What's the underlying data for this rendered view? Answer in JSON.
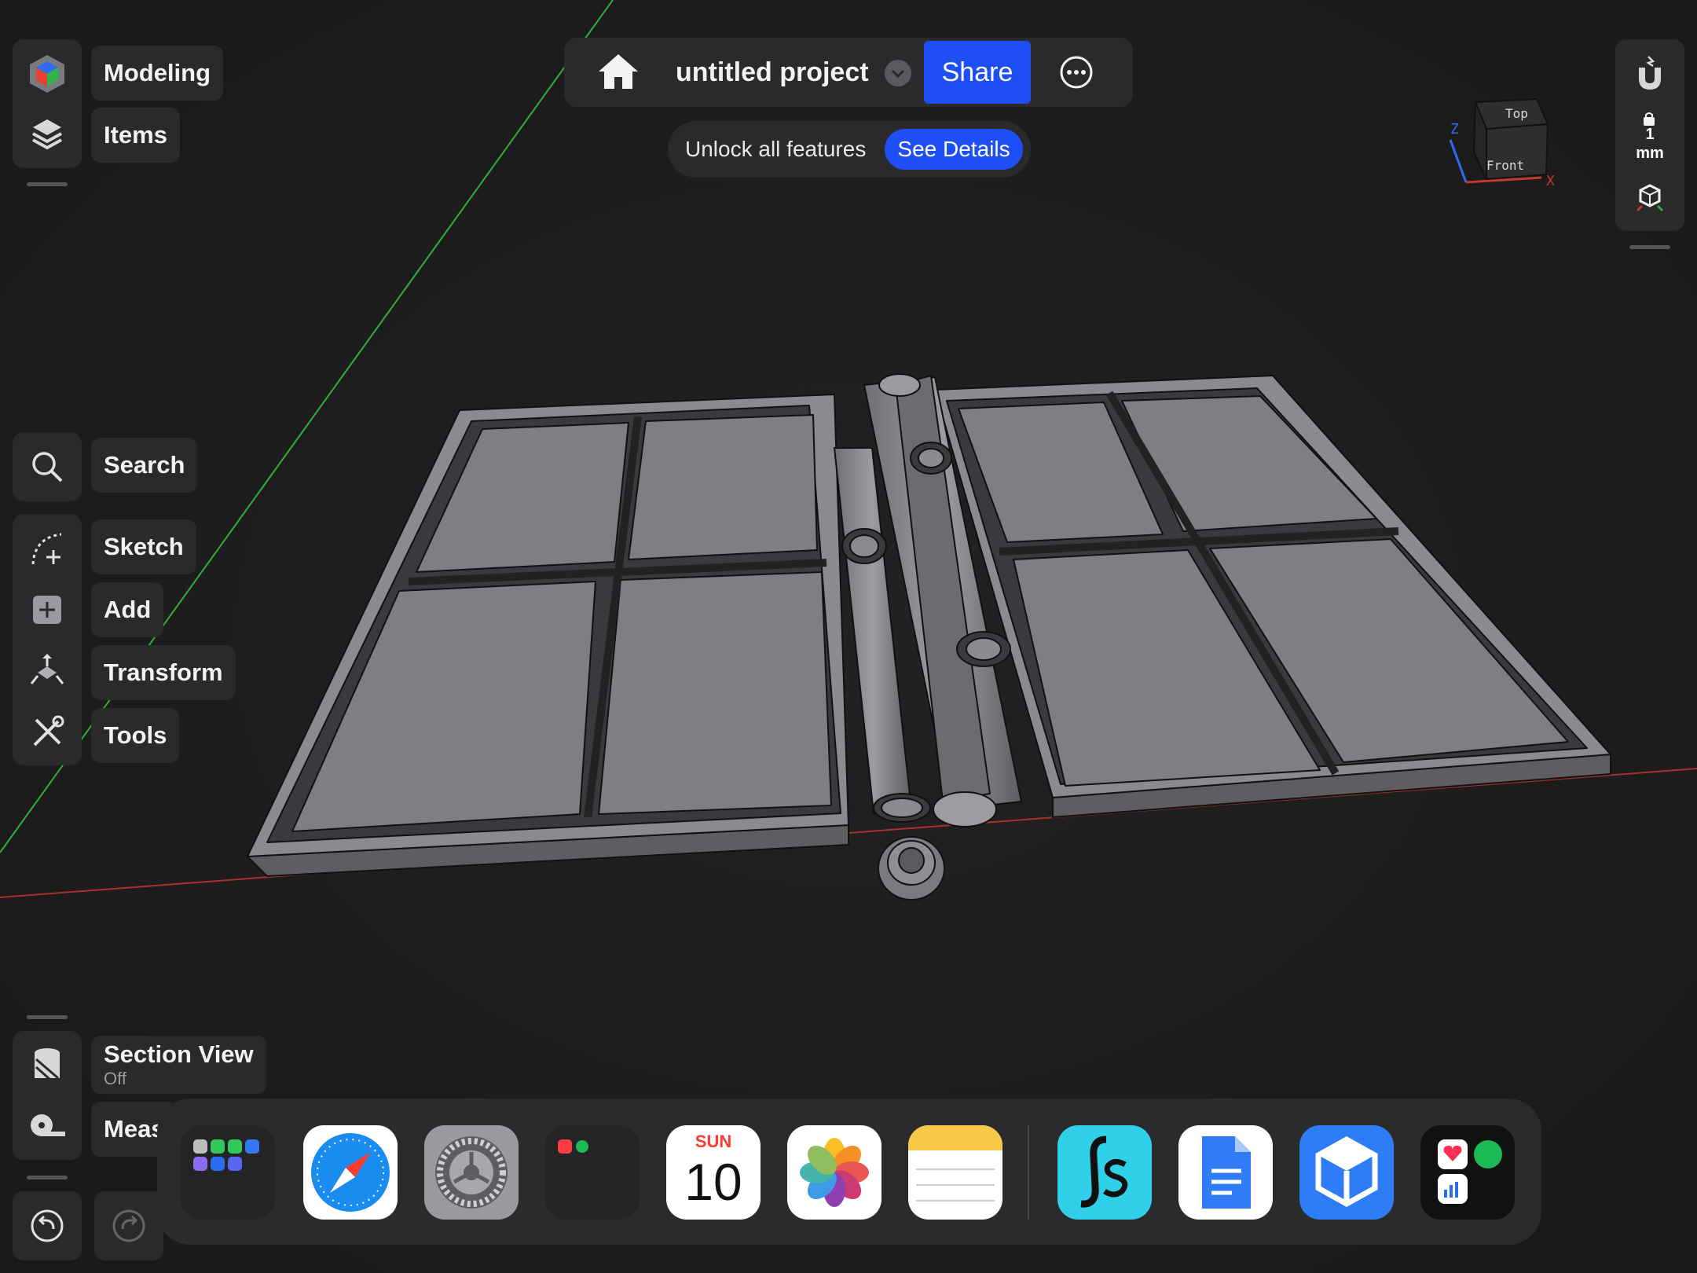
{
  "toolbar": {
    "modeling_label": "Modeling",
    "items_label": "Items",
    "search_label": "Search",
    "sketch_label": "Sketch",
    "add_label": "Add",
    "transform_label": "Transform",
    "tools_label": "Tools",
    "section_view_label": "Section View",
    "section_view_state": "Off",
    "measure_label": "Meas"
  },
  "header": {
    "project_title": "untitled project",
    "share_label": "Share"
  },
  "promo": {
    "text": "Unlock all features",
    "button_label": "See Details"
  },
  "right_panel": {
    "grid_value": "1",
    "grid_unit": "mm"
  },
  "view_cube": {
    "top_label": "Top",
    "front_label": "Front",
    "x_label": "X",
    "z_label": "Z"
  },
  "dock": {
    "calendar_day": "SUN",
    "calendar_date": "10",
    "apps": [
      "app-folder-messages",
      "safari",
      "settings",
      "app-folder-media",
      "calendar",
      "photos",
      "notes",
      "scriptable",
      "google-docs",
      "shapr3d",
      "app-folder-health"
    ]
  },
  "colors": {
    "accent": "#1e4ff5",
    "panel": "#2a2a2c",
    "background": "#1c1c1e",
    "axis_x": "#c0392b",
    "axis_y": "#2fae3a"
  }
}
